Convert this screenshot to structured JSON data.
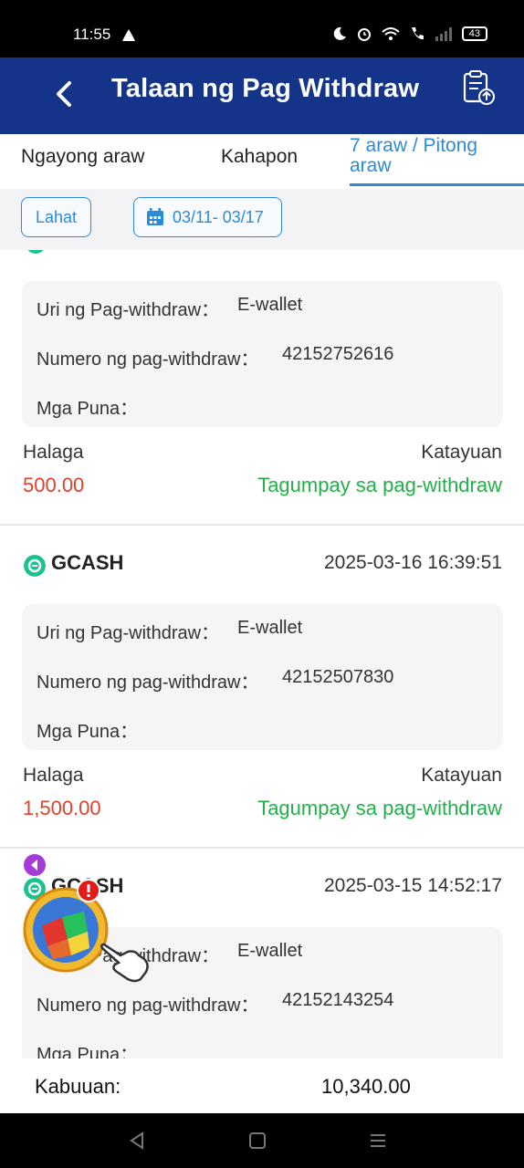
{
  "status": {
    "time": "11:55",
    "battery": "43"
  },
  "header": {
    "title": "Talaan ng Pag Withdraw"
  },
  "tabs": [
    {
      "label": "Ngayong araw"
    },
    {
      "label": "Kahapon"
    },
    {
      "label": "7 araw / Pitong araw"
    }
  ],
  "filter": {
    "all_label": "Lahat",
    "date_range": "03/11- 03/17"
  },
  "records": [
    {
      "detail_type_label": "Uri ng Pag-withdraw：",
      "detail_type_value": "E-wallet",
      "detail_number_label": "Numero ng pag-withdraw：",
      "detail_number_value": "42152752616",
      "detail_remarks_label": "Mga Puna：",
      "amount_label": "Halaga",
      "amount": "500.00",
      "status_label": "Katayuan",
      "status": "Tagumpay sa pag-withdraw"
    },
    {
      "method": "GCASH",
      "timestamp": "2025-03-16 16:39:51",
      "detail_type_label": "Uri ng Pag-withdraw：",
      "detail_type_value": "E-wallet",
      "detail_number_label": "Numero ng pag-withdraw：",
      "detail_number_value": "42152507830",
      "detail_remarks_label": "Mga Puna：",
      "amount_label": "Halaga",
      "amount": "1,500.00",
      "status_label": "Katayuan",
      "status": "Tagumpay sa pag-withdraw"
    },
    {
      "method": "GCASH",
      "timestamp": "2025-03-15 14:52:17",
      "detail_type_label": "Uri ng Pag-withdraw：",
      "detail_type_value": "E-wallet",
      "detail_number_label": "Numero ng pag-withdraw：",
      "detail_number_value": "42152143254",
      "detail_remarks_label": "Mga Puna："
    }
  ],
  "footer": {
    "total_label": "Kabuuan:",
    "total_value": "10,340.00"
  },
  "colors": {
    "header_bg": "#14348a",
    "accent": "#2d8ad6",
    "amount": "#e0412b",
    "success": "#22b04a"
  }
}
